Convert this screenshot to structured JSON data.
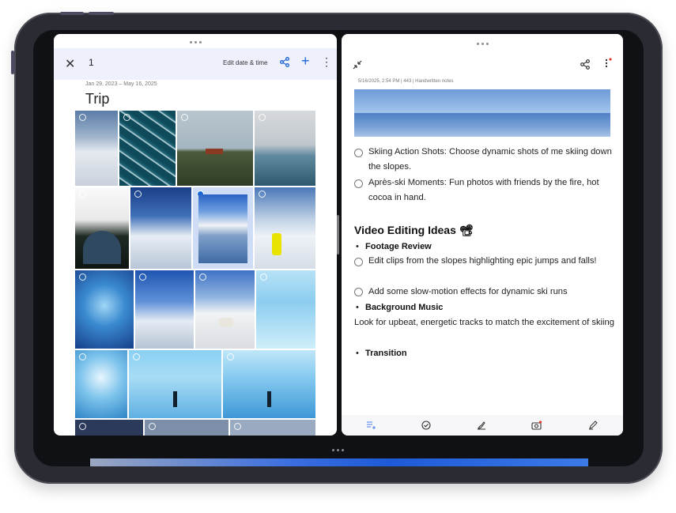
{
  "left_pane": {
    "close_label": "✕",
    "selected_count": "1",
    "edit_label": "Edit date & time",
    "add_label": "+",
    "more_label": "⋮",
    "date_range": "Jan 29, 2023 – May 16, 2025",
    "album_title": "Trip",
    "photos": [
      "frozen-lake-mountains",
      "ice-crack-pattern",
      "farmhouse-landscape",
      "iceberg-lake",
      "skier-jump-arch",
      "snowy-peaks-sky",
      "mountain-lake-selected",
      "hiker-yellow-jacket",
      "ice-cave-blue",
      "skier-mountains",
      "husky-snow-cabin",
      "frozen-waterfall",
      "ice-cave-light",
      "ice-formations-person",
      "ice-formation-wall",
      "partial-1",
      "partial-2",
      "partial-3"
    ]
  },
  "right_pane": {
    "meta": "5/16/2025, 2:54 PM  |  443  |  Handwritten notes",
    "items": [
      {
        "type": "check",
        "text": "Skiing Action Shots: Choose dynamic shots of me skiing down the slopes."
      },
      {
        "type": "check",
        "text": "Après-ski Moments: Fun photos with friends by the fire, hot cocoa in hand."
      }
    ],
    "heading": "Video Editing Ideas",
    "heading_emoji": "📽",
    "bullet1": "Footage Review",
    "check3": "Edit clips from the slopes highlighting epic jumps and falls!",
    "check4": "Add some slow-motion effects for dynamic ski runs",
    "bullet2": "Background Music",
    "paragraph": "Look for upbeat, energetic tracks to match the excitement of skiing",
    "bullet3": "Transition",
    "bullet_char": "•"
  },
  "colors": {
    "accent": "#1a66d6",
    "toolbar_bg": "#eef0fb",
    "tablet": "#2b2c33"
  },
  "icons": [
    "close-icon",
    "share-icon",
    "add-icon",
    "more-icon",
    "collapse-icon",
    "checklist-icon",
    "check-circle-icon",
    "brush-icon",
    "camera-icon",
    "pen-icon"
  ]
}
